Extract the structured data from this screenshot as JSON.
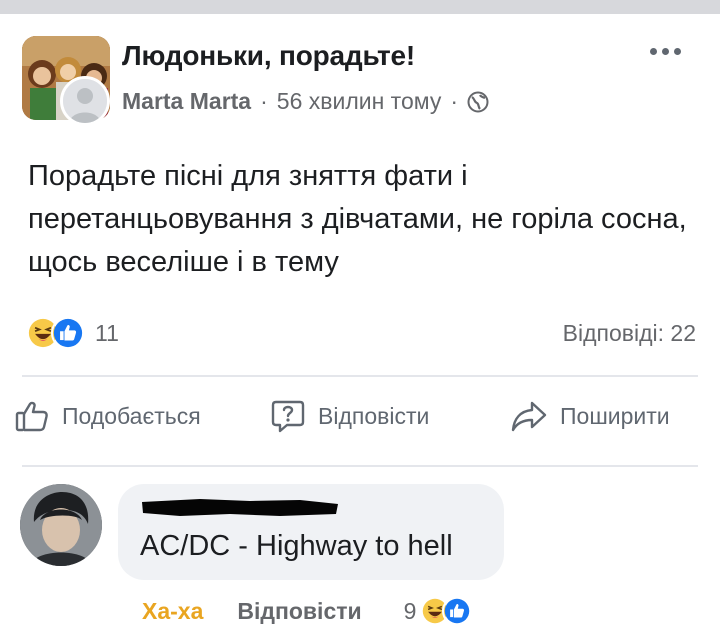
{
  "post": {
    "group_name": "Людоньки, порадьте!",
    "author": "Marta Marta",
    "separator": "·",
    "time": "56 хвилин тому",
    "text": "Порадьте пісні для зняття фати і перетанцьовування з дівчатами, не горіла сосна, щось веселіше і в тему",
    "reaction_count": "11",
    "replies": "Відповіді: 22",
    "reaction_icons": [
      "haha-icon",
      "like-icon"
    ]
  },
  "actions": {
    "like": "Подобається",
    "reply": "Відповісти",
    "share": "Поширити"
  },
  "comment": {
    "text": "AC/DC - Highway to hell",
    "react_label": "Ха-ха",
    "reply_label": "Відповісти",
    "reaction_count": "9"
  },
  "colors": {
    "secondary_text": "#65676b",
    "bubble": "#f0f2f5",
    "haha_reaction": "#e9a521",
    "like_blue": "#1877f2",
    "divider": "#e4e6eb"
  }
}
